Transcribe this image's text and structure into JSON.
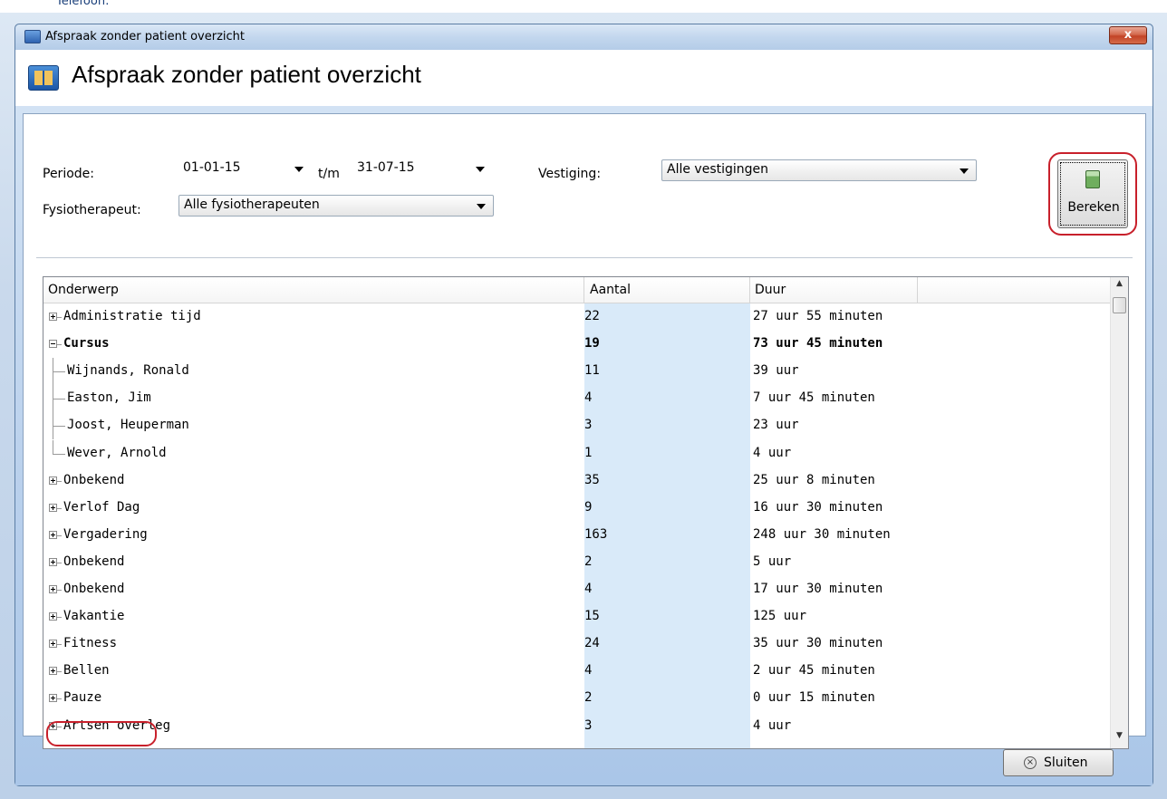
{
  "background": {
    "peek_text": "Telefoon:"
  },
  "window": {
    "title": "Afspraak zonder patient overzicht",
    "close_label": "x",
    "heading": "Afspraak zonder patient overzicht"
  },
  "filters": {
    "periode_label": "Periode:",
    "periode_from": "01-01-15",
    "periode_sep": "t/m",
    "periode_to": "31-07-15",
    "vestiging_label": "Vestiging:",
    "vestiging_value": "Alle vestigingen",
    "fysio_label": "Fysiotherapeut:",
    "fysio_value": "Alle fysiotherapeuten"
  },
  "bereken_label": "Bereken",
  "sluiten_label": "Sluiten",
  "table": {
    "columns": [
      "Onderwerp",
      "Aantal",
      "Duur"
    ],
    "rows": [
      {
        "onderwerp": "Administratie tijd",
        "aantal": "22",
        "duur": "27 uur 55 minuten",
        "level": 0,
        "expander": "plus"
      },
      {
        "onderwerp": "Cursus",
        "aantal": "19",
        "duur": "73 uur 45 minuten",
        "level": 0,
        "expander": "minus",
        "bold": true
      },
      {
        "onderwerp": "Wijnands, Ronald",
        "aantal": "11",
        "duur": "39 uur",
        "level": 1
      },
      {
        "onderwerp": "Easton, Jim",
        "aantal": "4",
        "duur": "7 uur 45 minuten",
        "level": 1
      },
      {
        "onderwerp": "Joost, Heuperman",
        "aantal": "3",
        "duur": "23 uur",
        "level": 1
      },
      {
        "onderwerp": "Wever, Arnold",
        "aantal": "1",
        "duur": "4 uur",
        "level": 1
      },
      {
        "onderwerp": "Onbekend",
        "aantal": "35",
        "duur": "25 uur 8 minuten",
        "level": 0,
        "expander": "plus"
      },
      {
        "onderwerp": "Verlof Dag",
        "aantal": "9",
        "duur": "16 uur 30 minuten",
        "level": 0,
        "expander": "plus"
      },
      {
        "onderwerp": "Vergadering",
        "aantal": "163",
        "duur": "248 uur 30 minuten",
        "level": 0,
        "expander": "plus"
      },
      {
        "onderwerp": "Onbekend",
        "aantal": "2",
        "duur": "5 uur",
        "level": 0,
        "expander": "plus"
      },
      {
        "onderwerp": "Onbekend",
        "aantal": "4",
        "duur": "17 uur 30 minuten",
        "level": 0,
        "expander": "plus"
      },
      {
        "onderwerp": "Vakantie",
        "aantal": "15",
        "duur": "125 uur",
        "level": 0,
        "expander": "plus"
      },
      {
        "onderwerp": "Fitness",
        "aantal": "24",
        "duur": "35 uur 30 minuten",
        "level": 0,
        "expander": "plus"
      },
      {
        "onderwerp": "Bellen",
        "aantal": "4",
        "duur": "2 uur 45 minuten",
        "level": 0,
        "expander": "plus"
      },
      {
        "onderwerp": "Pauze",
        "aantal": "2",
        "duur": "0 uur 15 minuten",
        "level": 0,
        "expander": "plus"
      },
      {
        "onderwerp": "Artsen overleg",
        "aantal": "3",
        "duur": "4 uur",
        "level": 0,
        "expander": "plus"
      }
    ]
  },
  "colors": {
    "highlight_ring": "#c8202b",
    "aantal_band": "#d9eaf9"
  }
}
